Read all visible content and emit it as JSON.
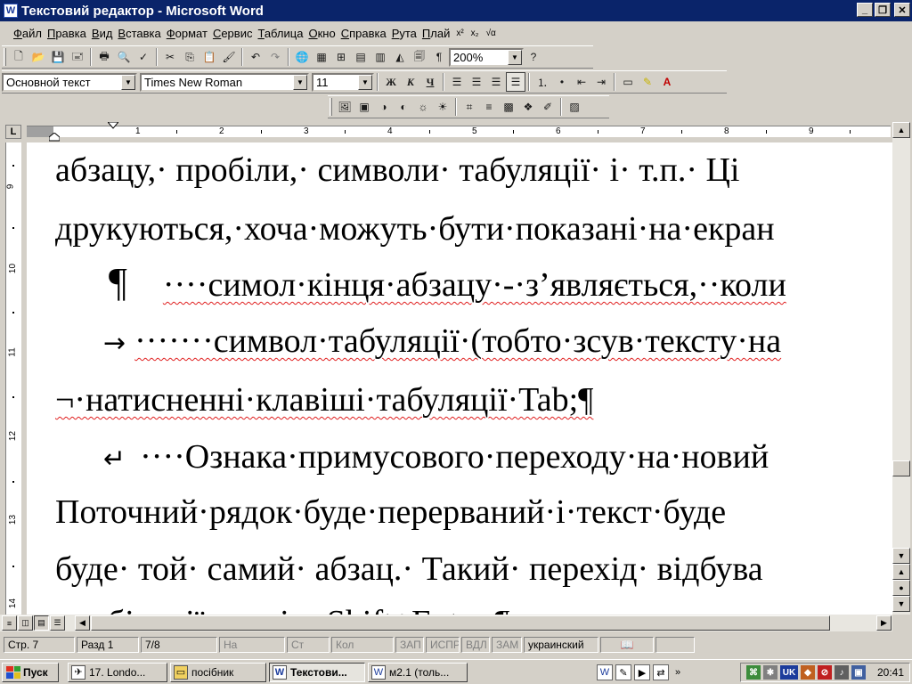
{
  "window": {
    "title": "Текстовий редактор - Microsoft Word",
    "minimize": "_",
    "restore": "❐",
    "close": "✕"
  },
  "menu": {
    "items": [
      "Файл",
      "Правка",
      "Вид",
      "Вставка",
      "Формат",
      "Сервис",
      "Таблица",
      "Окно",
      "Справка",
      "Рута",
      "Плай"
    ],
    "superscript": "x²",
    "subscript": "x₂",
    "equation": "√α"
  },
  "toolbar_standard": {
    "zoom": "200%"
  },
  "toolbar_format": {
    "style": "Основной текст",
    "font": "Times New Roman",
    "size": "11",
    "bold": "Ж",
    "italic": "К",
    "underline": "Ч"
  },
  "ruler": {
    "tab_selector": "L",
    "numbers": [
      "1",
      "2",
      "3",
      "4",
      "5",
      "6",
      "7",
      "8",
      "9"
    ],
    "vertical_numbers": [
      "9",
      "10",
      "11",
      "12",
      "13",
      "14"
    ]
  },
  "document": {
    "lines": [
      "абзацу,· пробіли,· символи· табуляції· і· т.п.· Ці",
      "друкуються,·хоча·можуть·бути·показані·на·екран",
      "····симол·кінця·абзацу·-·з’являється,··коли",
      "·······символ·табуляції·(тобто·зсув·тексту·на",
      "¬·натисненні·клавіші·табуляції·Tab;¶",
      "····Ознака·примусового·переходу·на·новий",
      "Поточний·рядок·буде·перерваний·і·текст·буде",
      "буде· той· самий· абзац.· Такий· перехід· відбува",
      "комбінації·клавіш·Shift+Enter;¶"
    ],
    "symbol_pilcrow": "¶",
    "symbol_tab": "→",
    "symbol_break": "↵"
  },
  "status": {
    "page": "Стр. 7",
    "section": "Разд 1",
    "pages": "7/8",
    "at": "На",
    "line": "Ст",
    "col": "Кол",
    "rec": "ЗАП",
    "trk": "ИСПР",
    "ext": "ВДЛ",
    "ovr": "ЗАМ",
    "language": "украинский"
  },
  "taskbar": {
    "start": "Пуск",
    "tasks": [
      "17. Londo...",
      "посібник",
      "Текстови...",
      "м2.1 (толь..."
    ],
    "clock": "20:41",
    "lang": "UK"
  },
  "colors": {
    "titlebar": "#0a246a",
    "face": "#d4d0c8",
    "spell_underline": "#e02020"
  }
}
